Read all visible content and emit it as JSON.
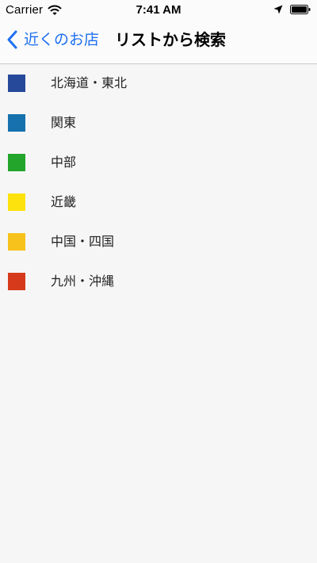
{
  "status_bar": {
    "carrier": "Carrier",
    "time": "7:41 AM",
    "icons": [
      "wifi-icon",
      "location-arrow-icon",
      "battery-icon"
    ]
  },
  "nav": {
    "back_label": "近くのお店",
    "title": "リストから検索"
  },
  "colors": {
    "accent": "#1e6ff1",
    "background": "#f6f6f6",
    "nav_background": "#fbfbfb"
  },
  "regions": [
    {
      "label": "北海道・東北",
      "color": "#27499a"
    },
    {
      "label": "関東",
      "color": "#1671ad"
    },
    {
      "label": "中部",
      "color": "#22a52a"
    },
    {
      "label": "近畿",
      "color": "#fde20e"
    },
    {
      "label": "中国・四国",
      "color": "#f7c21b"
    },
    {
      "label": "九州・沖縄",
      "color": "#d53a1b"
    }
  ]
}
